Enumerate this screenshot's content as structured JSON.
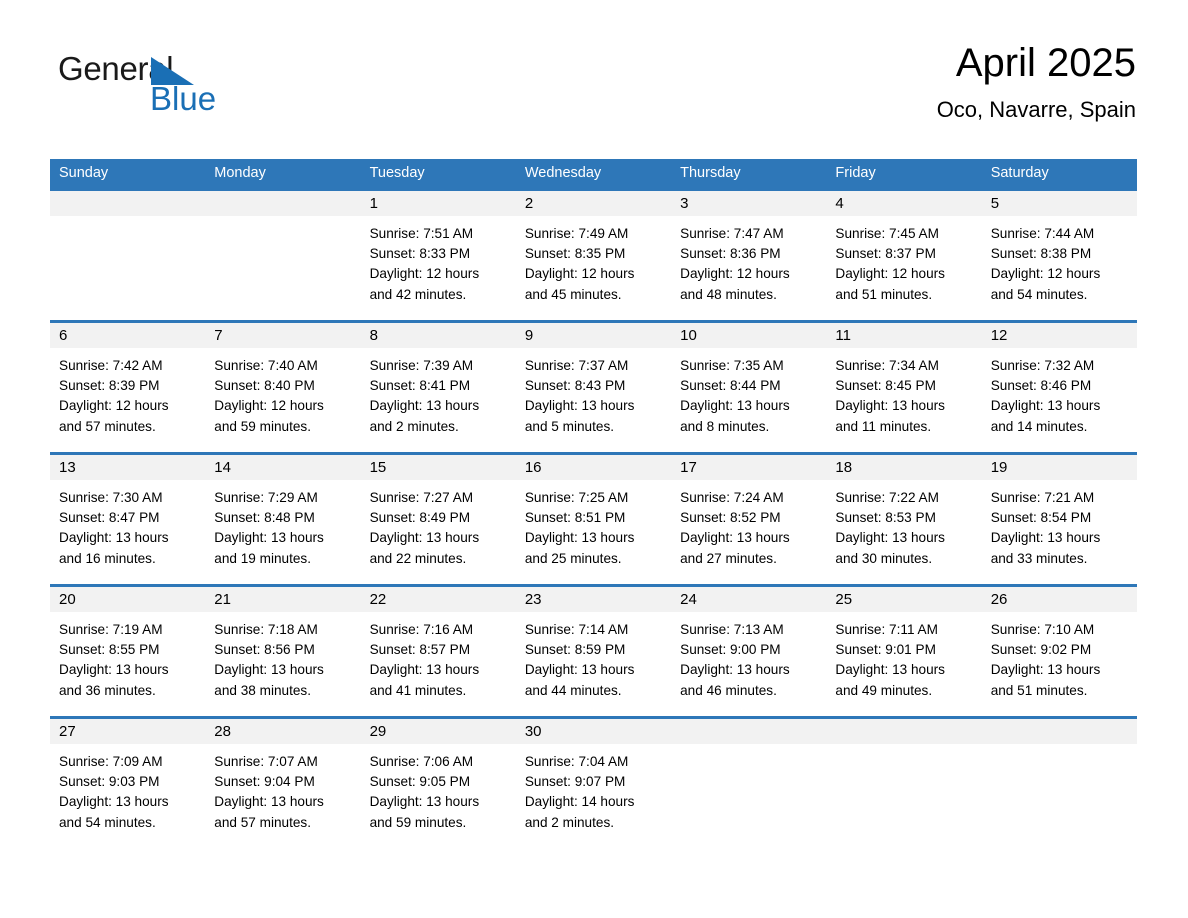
{
  "brand": {
    "name_part1": "General",
    "name_part2": "Blue",
    "accent_color": "#1a6fb5"
  },
  "header": {
    "title": "April 2025",
    "subtitle": "Oco, Navarre, Spain"
  },
  "theme": {
    "header_blue": "#2e77b8",
    "band_gray": "#f2f2f2"
  },
  "weekdays": [
    {
      "label": "Sunday"
    },
    {
      "label": "Monday"
    },
    {
      "label": "Tuesday"
    },
    {
      "label": "Wednesday"
    },
    {
      "label": "Thursday"
    },
    {
      "label": "Friday"
    },
    {
      "label": "Saturday"
    }
  ],
  "weeks": [
    [
      {
        "day": "",
        "sunrise": "",
        "sunset": "",
        "daylight1": "",
        "daylight2": ""
      },
      {
        "day": "",
        "sunrise": "",
        "sunset": "",
        "daylight1": "",
        "daylight2": ""
      },
      {
        "day": "1",
        "sunrise": "Sunrise: 7:51 AM",
        "sunset": "Sunset: 8:33 PM",
        "daylight1": "Daylight: 12 hours",
        "daylight2": "and 42 minutes."
      },
      {
        "day": "2",
        "sunrise": "Sunrise: 7:49 AM",
        "sunset": "Sunset: 8:35 PM",
        "daylight1": "Daylight: 12 hours",
        "daylight2": "and 45 minutes."
      },
      {
        "day": "3",
        "sunrise": "Sunrise: 7:47 AM",
        "sunset": "Sunset: 8:36 PM",
        "daylight1": "Daylight: 12 hours",
        "daylight2": "and 48 minutes."
      },
      {
        "day": "4",
        "sunrise": "Sunrise: 7:45 AM",
        "sunset": "Sunset: 8:37 PM",
        "daylight1": "Daylight: 12 hours",
        "daylight2": "and 51 minutes."
      },
      {
        "day": "5",
        "sunrise": "Sunrise: 7:44 AM",
        "sunset": "Sunset: 8:38 PM",
        "daylight1": "Daylight: 12 hours",
        "daylight2": "and 54 minutes."
      }
    ],
    [
      {
        "day": "6",
        "sunrise": "Sunrise: 7:42 AM",
        "sunset": "Sunset: 8:39 PM",
        "daylight1": "Daylight: 12 hours",
        "daylight2": "and 57 minutes."
      },
      {
        "day": "7",
        "sunrise": "Sunrise: 7:40 AM",
        "sunset": "Sunset: 8:40 PM",
        "daylight1": "Daylight: 12 hours",
        "daylight2": "and 59 minutes."
      },
      {
        "day": "8",
        "sunrise": "Sunrise: 7:39 AM",
        "sunset": "Sunset: 8:41 PM",
        "daylight1": "Daylight: 13 hours",
        "daylight2": "and 2 minutes."
      },
      {
        "day": "9",
        "sunrise": "Sunrise: 7:37 AM",
        "sunset": "Sunset: 8:43 PM",
        "daylight1": "Daylight: 13 hours",
        "daylight2": "and 5 minutes."
      },
      {
        "day": "10",
        "sunrise": "Sunrise: 7:35 AM",
        "sunset": "Sunset: 8:44 PM",
        "daylight1": "Daylight: 13 hours",
        "daylight2": "and 8 minutes."
      },
      {
        "day": "11",
        "sunrise": "Sunrise: 7:34 AM",
        "sunset": "Sunset: 8:45 PM",
        "daylight1": "Daylight: 13 hours",
        "daylight2": "and 11 minutes."
      },
      {
        "day": "12",
        "sunrise": "Sunrise: 7:32 AM",
        "sunset": "Sunset: 8:46 PM",
        "daylight1": "Daylight: 13 hours",
        "daylight2": "and 14 minutes."
      }
    ],
    [
      {
        "day": "13",
        "sunrise": "Sunrise: 7:30 AM",
        "sunset": "Sunset: 8:47 PM",
        "daylight1": "Daylight: 13 hours",
        "daylight2": "and 16 minutes."
      },
      {
        "day": "14",
        "sunrise": "Sunrise: 7:29 AM",
        "sunset": "Sunset: 8:48 PM",
        "daylight1": "Daylight: 13 hours",
        "daylight2": "and 19 minutes."
      },
      {
        "day": "15",
        "sunrise": "Sunrise: 7:27 AM",
        "sunset": "Sunset: 8:49 PM",
        "daylight1": "Daylight: 13 hours",
        "daylight2": "and 22 minutes."
      },
      {
        "day": "16",
        "sunrise": "Sunrise: 7:25 AM",
        "sunset": "Sunset: 8:51 PM",
        "daylight1": "Daylight: 13 hours",
        "daylight2": "and 25 minutes."
      },
      {
        "day": "17",
        "sunrise": "Sunrise: 7:24 AM",
        "sunset": "Sunset: 8:52 PM",
        "daylight1": "Daylight: 13 hours",
        "daylight2": "and 27 minutes."
      },
      {
        "day": "18",
        "sunrise": "Sunrise: 7:22 AM",
        "sunset": "Sunset: 8:53 PM",
        "daylight1": "Daylight: 13 hours",
        "daylight2": "and 30 minutes."
      },
      {
        "day": "19",
        "sunrise": "Sunrise: 7:21 AM",
        "sunset": "Sunset: 8:54 PM",
        "daylight1": "Daylight: 13 hours",
        "daylight2": "and 33 minutes."
      }
    ],
    [
      {
        "day": "20",
        "sunrise": "Sunrise: 7:19 AM",
        "sunset": "Sunset: 8:55 PM",
        "daylight1": "Daylight: 13 hours",
        "daylight2": "and 36 minutes."
      },
      {
        "day": "21",
        "sunrise": "Sunrise: 7:18 AM",
        "sunset": "Sunset: 8:56 PM",
        "daylight1": "Daylight: 13 hours",
        "daylight2": "and 38 minutes."
      },
      {
        "day": "22",
        "sunrise": "Sunrise: 7:16 AM",
        "sunset": "Sunset: 8:57 PM",
        "daylight1": "Daylight: 13 hours",
        "daylight2": "and 41 minutes."
      },
      {
        "day": "23",
        "sunrise": "Sunrise: 7:14 AM",
        "sunset": "Sunset: 8:59 PM",
        "daylight1": "Daylight: 13 hours",
        "daylight2": "and 44 minutes."
      },
      {
        "day": "24",
        "sunrise": "Sunrise: 7:13 AM",
        "sunset": "Sunset: 9:00 PM",
        "daylight1": "Daylight: 13 hours",
        "daylight2": "and 46 minutes."
      },
      {
        "day": "25",
        "sunrise": "Sunrise: 7:11 AM",
        "sunset": "Sunset: 9:01 PM",
        "daylight1": "Daylight: 13 hours",
        "daylight2": "and 49 minutes."
      },
      {
        "day": "26",
        "sunrise": "Sunrise: 7:10 AM",
        "sunset": "Sunset: 9:02 PM",
        "daylight1": "Daylight: 13 hours",
        "daylight2": "and 51 minutes."
      }
    ],
    [
      {
        "day": "27",
        "sunrise": "Sunrise: 7:09 AM",
        "sunset": "Sunset: 9:03 PM",
        "daylight1": "Daylight: 13 hours",
        "daylight2": "and 54 minutes."
      },
      {
        "day": "28",
        "sunrise": "Sunrise: 7:07 AM",
        "sunset": "Sunset: 9:04 PM",
        "daylight1": "Daylight: 13 hours",
        "daylight2": "and 57 minutes."
      },
      {
        "day": "29",
        "sunrise": "Sunrise: 7:06 AM",
        "sunset": "Sunset: 9:05 PM",
        "daylight1": "Daylight: 13 hours",
        "daylight2": "and 59 minutes."
      },
      {
        "day": "30",
        "sunrise": "Sunrise: 7:04 AM",
        "sunset": "Sunset: 9:07 PM",
        "daylight1": "Daylight: 14 hours",
        "daylight2": "and 2 minutes."
      },
      {
        "day": "",
        "sunrise": "",
        "sunset": "",
        "daylight1": "",
        "daylight2": ""
      },
      {
        "day": "",
        "sunrise": "",
        "sunset": "",
        "daylight1": "",
        "daylight2": ""
      },
      {
        "day": "",
        "sunrise": "",
        "sunset": "",
        "daylight1": "",
        "daylight2": ""
      }
    ]
  ]
}
